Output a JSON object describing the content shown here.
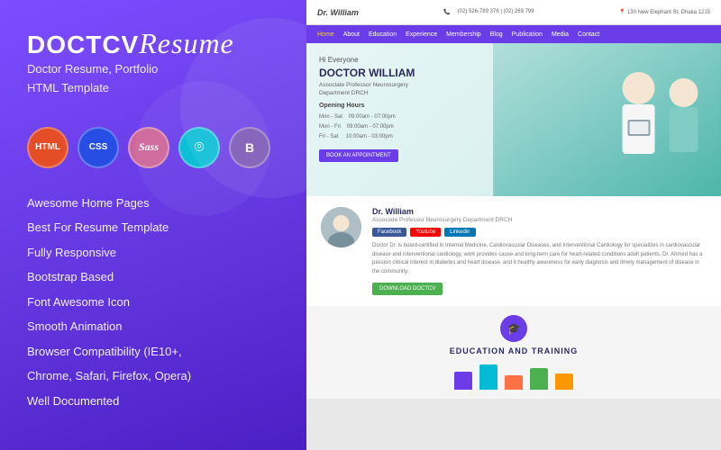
{
  "left": {
    "logo": {
      "part1": "DOCTCV",
      "part2": "Resume",
      "subtitle_line1": "Doctor Resume, Portfolio",
      "subtitle_line2": "HTML Template"
    },
    "badges": [
      {
        "id": "html",
        "label": "HTML",
        "class": "badge-html"
      },
      {
        "id": "css",
        "label": "CSS",
        "class": "badge-css"
      },
      {
        "id": "sass",
        "label": "Sass",
        "class": "badge-sass"
      },
      {
        "id": "angular",
        "label": "~",
        "class": "badge-angular"
      },
      {
        "id": "bootstrap",
        "label": "B",
        "class": "badge-bootstrap"
      }
    ],
    "features": [
      "Awesome Home Pages",
      "Best For Resume Template",
      "Fully Responsive",
      "Bootstrap Based",
      "Font Awesome Icon",
      "Smooth Animation",
      "Browser Compatibility (IE10+,",
      "Chrome, Safari, Firefox, Opera)",
      "Well Documented"
    ]
  },
  "preview": {
    "topbar": {
      "brand": "Dr. William",
      "phone": "(02) 526-789 376 | (02) 269 799",
      "address": "130 New Elephant St, Dhaka 1215"
    },
    "nav": {
      "items": [
        "Home",
        "About",
        "Education",
        "Experience",
        "Membership",
        "Blog",
        "Publication",
        "Media",
        "Contact"
      ],
      "active": "Home"
    },
    "hero": {
      "greeting": "Hi Everyone",
      "name": "DOCTOR WILLIAM",
      "subtitle": "Associate Professor Neurosurgery\nDepartment DRCH",
      "hours_title": "Opening Hours",
      "hours": [
        {
          "days": "Mon - Sat",
          "time1": "09:00am - 07:00pm"
        },
        {
          "days": "Mon - Fri",
          "time1": "09:00am - 07:00pm"
        },
        {
          "days": "Fri - Sat",
          "time1": "10:00am - 03:00pm"
        }
      ],
      "cta": "BOOK AN APPOINTMENT"
    },
    "about": {
      "name": "Dr. William",
      "title": "Associate Professor Neurosurgery Department DRCH",
      "social": [
        "Facebook",
        "Youtube",
        "Linkedin"
      ],
      "bio": "Doctor Dr. is board-certified in Internal Medicine, Cardiovascular Diseases, and Interventional Cardiology for specializes in cardiovascular disease and interventional cardiology, work provides cause and long-term care for heart-related conditions adult patients. Dr. Ahmed has a passion clinical interest in diabetes and heart disease, and it healthy awareness for early diagnosis and timely management of disease in the community.",
      "download": "DOWNLOAD DOCTCV"
    },
    "education": {
      "icon": "🎓",
      "title": "EDUCATION AND TRAINING",
      "bars": [
        {
          "height": 20,
          "color": "#6a3de8"
        },
        {
          "height": 28,
          "color": "#00bcd4"
        },
        {
          "height": 16,
          "color": "#ff7043"
        },
        {
          "height": 24,
          "color": "#4caf50"
        },
        {
          "height": 18,
          "color": "#ff9800"
        }
      ]
    }
  }
}
